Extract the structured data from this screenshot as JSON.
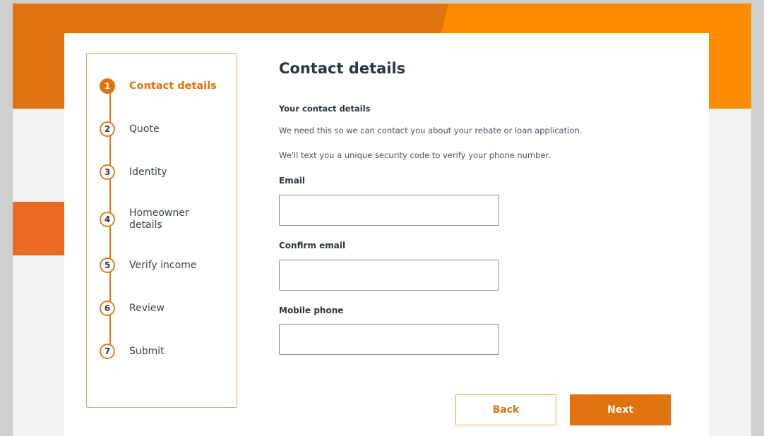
{
  "stepper": {
    "steps": [
      {
        "number": "1",
        "label": "Contact details",
        "active": true
      },
      {
        "number": "2",
        "label": "Quote"
      },
      {
        "number": "3",
        "label": "Identity"
      },
      {
        "number": "4",
        "label": "Homeowner details"
      },
      {
        "number": "5",
        "label": "Verify income"
      },
      {
        "number": "6",
        "label": "Review"
      },
      {
        "number": "7",
        "label": "Submit"
      }
    ]
  },
  "main": {
    "title": "Contact details",
    "section_heading": "Your contact details",
    "intro_lines": [
      "We need this so we can contact you about your rebate or loan application.",
      "We'll text you a unique security code to verify your phone number."
    ],
    "fields": [
      {
        "label": "Email",
        "value": ""
      },
      {
        "label": "Confirm email",
        "value": ""
      },
      {
        "label": "Mobile phone",
        "value": ""
      }
    ]
  },
  "actions": {
    "back_label": "Back",
    "next_label": "Next"
  },
  "colors": {
    "accent": "#e0720f",
    "accent_light": "#fb8c00",
    "stepper_border": "#f3a35a"
  }
}
